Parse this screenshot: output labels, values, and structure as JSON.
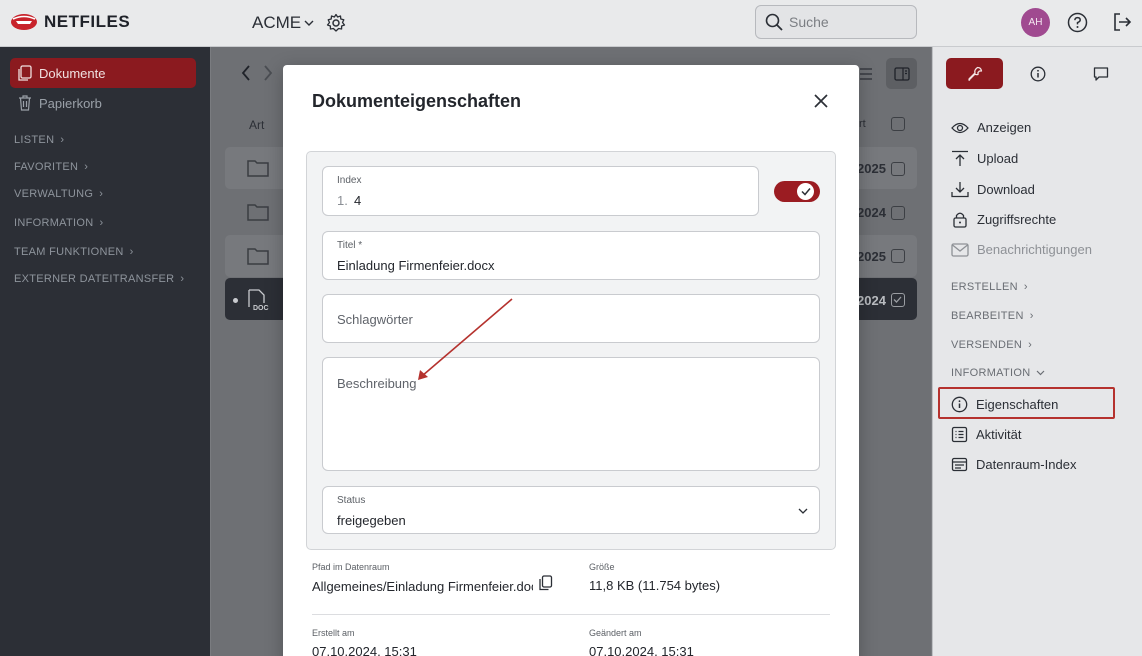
{
  "header": {
    "logo_text": "NETFILES",
    "workspace": "ACME",
    "search_placeholder": "Suche",
    "avatar_initials": "AH"
  },
  "sidebar": {
    "items": [
      {
        "label": "Dokumente",
        "active": true
      },
      {
        "label": "Papierkorb"
      }
    ],
    "sections": [
      "LISTEN",
      "FAVORITEN",
      "VERWALTUNG",
      "INFORMATION",
      "TEAM FUNKTIONEN",
      "EXTERNER DATEITRANSFER"
    ]
  },
  "content": {
    "column_art": "Art",
    "column_right": "rt",
    "rows": [
      {
        "date": "2025"
      },
      {
        "date": "2024"
      },
      {
        "date": "2025"
      },
      {
        "date": "2024"
      }
    ],
    "doc_label": "DOC"
  },
  "right_panel": {
    "actions": [
      "Anzeigen",
      "Upload",
      "Download",
      "Zugriffsrechte",
      "Benachrichtigungen"
    ],
    "sections": [
      "ERSTELLEN",
      "BEARBEITEN",
      "VERSENDEN",
      "INFORMATION"
    ],
    "info_items": [
      "Eigenschaften",
      "Aktivität",
      "Datenraum-Index"
    ]
  },
  "modal": {
    "title": "Dokumenteigenschaften",
    "index_label": "Index",
    "index_prefix": "1.",
    "index_value": "4",
    "title_label": "Titel *",
    "title_value": "Einladung Firmenfeier.docx",
    "keywords_placeholder": "Schlagwörter",
    "description_placeholder": "Beschreibung",
    "status_label": "Status",
    "status_value": "freigegeben",
    "path_label": "Pfad im Datenraum",
    "path_value": "Allgemeines/Einladung Firmenfeier.docx",
    "size_label": "Größe",
    "size_value": "11,8 KB (11.754 bytes)",
    "created_label": "Erstellt am",
    "created_value": "07.10.2024, 15:31",
    "modified_label": "Geändert am",
    "modified_value": "07.10.2024, 15:31"
  },
  "colors": {
    "brand": "#8b1a1f",
    "sidebar_bg": "#2c2f36",
    "highlight": "#b5322e"
  }
}
